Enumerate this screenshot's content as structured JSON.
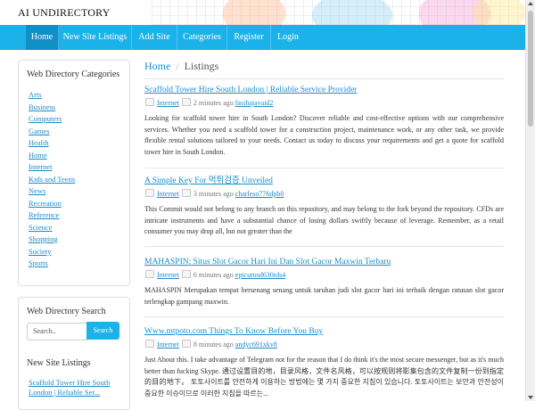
{
  "site": {
    "title": "AI UNDIRECTORY"
  },
  "nav": {
    "items": [
      {
        "label": "Home",
        "active": true
      },
      {
        "label": "New Site Listings",
        "active": false
      },
      {
        "label": "Add Site",
        "active": false
      },
      {
        "label": "Categories",
        "active": false
      },
      {
        "label": "Register",
        "active": false
      },
      {
        "label": "Login",
        "active": false
      }
    ]
  },
  "sidebar": {
    "categories_title": "Web Directory Categories",
    "categories": [
      "Arts",
      "Business",
      "Computers",
      "Games",
      "Health",
      "Home",
      "Internet",
      "Kids and Teens",
      "News",
      "Recreation",
      "Reference",
      "Science",
      "Shopping",
      "Society",
      "Sports"
    ],
    "search_title": "Web Directory Search",
    "search_placeholder": "Search..",
    "search_button": "Search",
    "new_listings_title": "New Site Listings",
    "new_listings": [
      "Scaffold Tower Hire South London | Reliable Ser..."
    ]
  },
  "breadcrumb": {
    "home": "Home",
    "separator": "/",
    "current": "Listings"
  },
  "listings": [
    {
      "title": "Scaffold Tower Hire South London | Reliable Service Provider",
      "category": "Internet",
      "time": "2 minutes ago",
      "user": "fasihajavaid2",
      "description": "Looking for scaffold tower hire in South London? Discover reliable and cost-effective options with our comprehensive services. Whether you need a scaffold tower for a construction project, maintenance work, or any other task, we provide flexible rental solutions tailored to your needs. Contact us today to discuss your requirements and get a quote for scaffold tower hire in South London."
    },
    {
      "title": "A Simple Key For 먹튀검증 Unveiled",
      "category": "Internet",
      "time": "3 minutes ago",
      "user": "charleso776dpb0",
      "description": "This Commit would not belong to any branch on this repository, and may belong to the fork beyond the repository. CFDs are intricate instruments and have a substantial chance of losing dollars swiftly because of leverage. Remember, as a retail consumer you may drop all, but not greater than the"
    },
    {
      "title": "MAHASPIN: Situs Slot Gacor Hari Ini Dan Slot Gacor Maxwin Terbaru",
      "category": "Internet",
      "time": "6 minutes ago",
      "user": "epicurusd630tds4",
      "description": "MAHASPIN Merupakan tempat bersenang senang untuk taruhan judi slot gacor hari ini terbaik dengan ratusan slot gacor terlengkap gampang maxwin."
    },
    {
      "title": "Www.mtpoto.com Things To Know Before You Buy",
      "category": "Internet",
      "time": "8 minutes ago",
      "user": "andyc691xkv8",
      "description": "Just About this. I take advantage of Telegram not for the reason that I do think it's the most secure messenger, but as it's much better than fucking Skype. 通过设置目的地，目录风格，文件名风格，可以按规则将影集包含的文件复制一份到指定的目的地下。 토토사이트를 안전하게 이용하는 방법에는 몇 가지 중요한 지침이 있습니다. 토토사이트는 보안과 안전성이 중요한 이슈이므로 이러한 지침을 따르는..."
    }
  ]
}
